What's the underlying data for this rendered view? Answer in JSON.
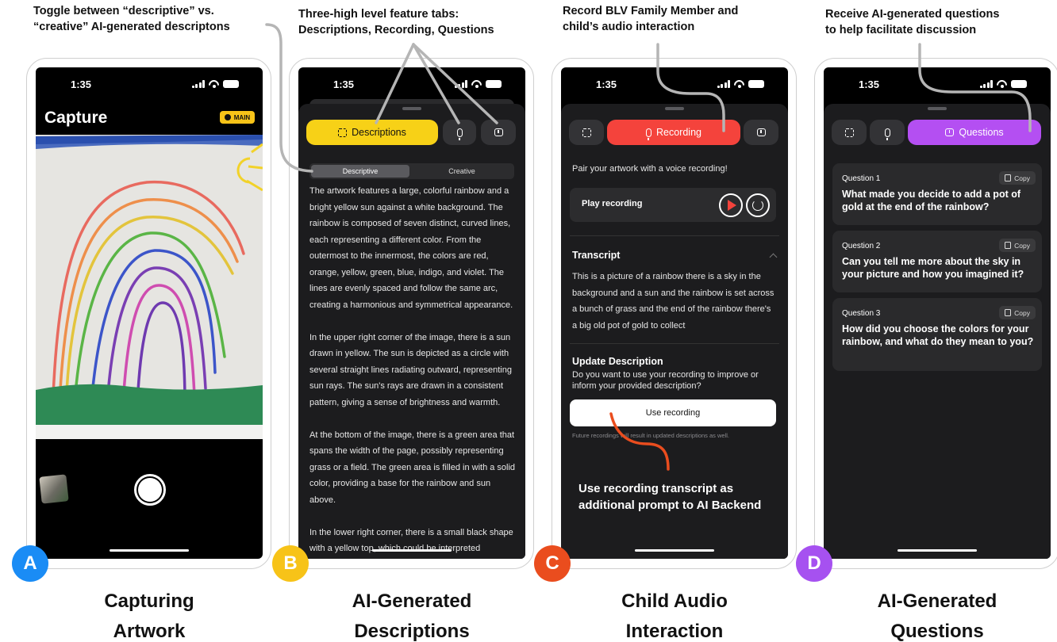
{
  "annotations": {
    "a": "Toggle between “descriptive” vs.\n“creative” AI-generated descriptons",
    "b": "Three-high level feature tabs:\nDescriptions, Recording, Questions",
    "c": "Record BLV Family Member and\nchild’s audio interaction",
    "d": "Receive AI-generated questions\nto help facilitate discussion",
    "c_bottom": "Use recording transcript as\nadditional prompt to AI Backend"
  },
  "status_time": "1:35",
  "badges": {
    "a": "A",
    "b": "B",
    "c": "C",
    "d": "D"
  },
  "captions": {
    "a": "Capturing\nArtwork",
    "b": "AI-Generated\nDescriptions",
    "c": "Child Audio\nInteraction",
    "d": "AI-Generated\nQuestions"
  },
  "screen_a": {
    "title": "Capture",
    "mode_badge": "MAIN"
  },
  "tabs": {
    "descriptions": "Descriptions",
    "recording": "Recording",
    "questions": "Questions"
  },
  "screen_b": {
    "toggle": {
      "descriptive": "Descriptive",
      "creative": "Creative"
    },
    "paragraphs": [
      "The artwork features a large, colorful rainbow and a bright yellow sun against a white background. The rainbow is composed of seven distinct, curved lines, each representing a different color. From the outermost to the innermost, the colors are red, orange, yellow, green, blue, indigo, and violet. The lines are evenly spaced and follow the same arc, creating a harmonious and symmetrical appearance.",
      "In the upper right corner of the image, there is a sun drawn in yellow. The sun is depicted as a circle with several straight lines radiating outward, representing sun rays. The sun's rays are drawn in a consistent pattern, giving a sense of brightness and warmth.",
      "At the bottom of the image, there is a green area that spans the width of the page, possibly representing grass or a field. The green area is filled in with a solid color, providing a base for the rainbow and sun above.",
      "In the lower right corner, there is a small black shape with a yellow top, which could be interpreted"
    ]
  },
  "screen_c": {
    "intro": "Pair your artwork with a voice recording!",
    "play_label": "Play recording",
    "transcript_heading": "Transcript",
    "transcript_text": "This is a picture of a rainbow there is a sky in the background and a sun and the rainbow is set across a bunch of grass and the end of the rainbow there's a big old pot of gold to collect",
    "update_heading": "Update Description",
    "update_text": "Do you want to use your recording to improve or inform your provided description?",
    "use_button": "Use recording",
    "footnote": "Future recordings will result in updated descriptions as well."
  },
  "screen_d": {
    "copy_label": "Copy",
    "questions": [
      {
        "label": "Question 1",
        "text": "What made you decide to add a pot of gold at the end of the rainbow?"
      },
      {
        "label": "Question 2",
        "text": "Can you tell me more about the sky in your picture and how you imagined it?"
      },
      {
        "label": "Question 3",
        "text": "How did you choose the colors for your rainbow, and what do they mean to you?"
      }
    ]
  },
  "colors": {
    "badge_a": "#1a8cf5",
    "badge_b": "#f7c318",
    "badge_c": "#ea4d1e",
    "badge_d": "#a651f0",
    "tab_descriptions": "#f7d117",
    "tab_recording": "#f4433c",
    "tab_questions": "#b44ff2",
    "annotation_line": "#b5b5b5",
    "annotation_line_orange": "#ea4d1e"
  }
}
